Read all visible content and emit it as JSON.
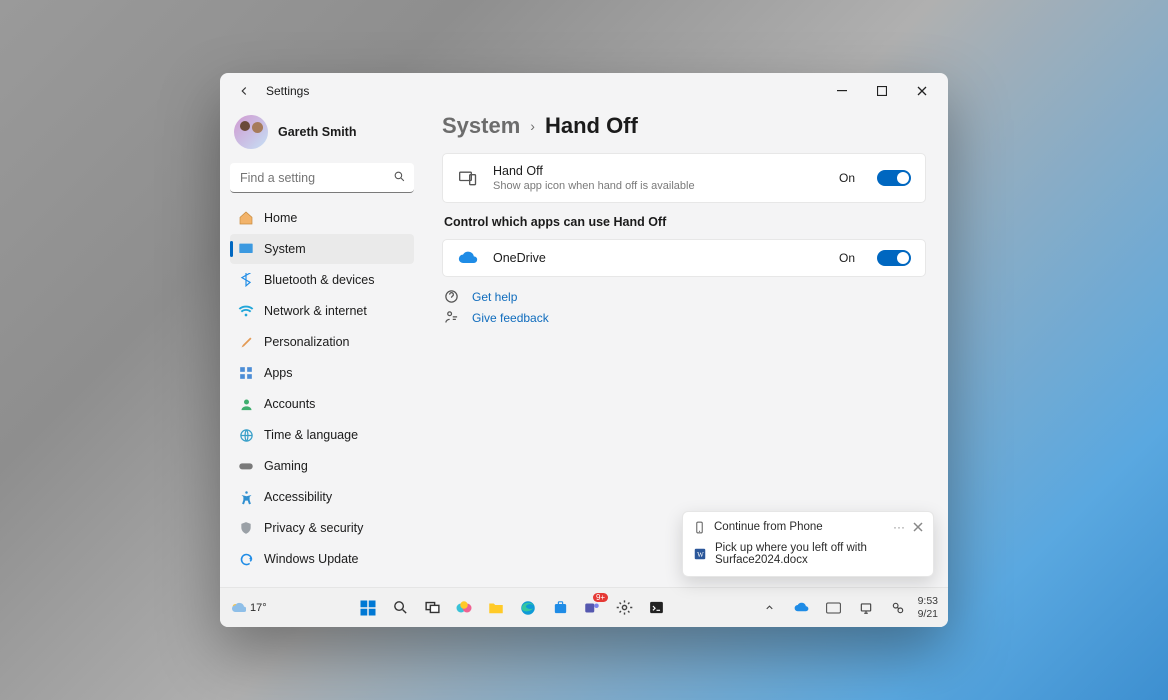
{
  "titlebar": {
    "title": "Settings"
  },
  "profile": {
    "name": "Gareth Smith"
  },
  "search": {
    "placeholder": "Find a setting"
  },
  "sidebar": {
    "items": [
      {
        "label": "Home",
        "icon": "home-icon"
      },
      {
        "label": "System",
        "icon": "system-icon"
      },
      {
        "label": "Bluetooth & devices",
        "icon": "bluetooth-icon"
      },
      {
        "label": "Network & internet",
        "icon": "wifi-icon"
      },
      {
        "label": "Personalization",
        "icon": "brush-icon"
      },
      {
        "label": "Apps",
        "icon": "apps-icon"
      },
      {
        "label": "Accounts",
        "icon": "person-icon"
      },
      {
        "label": "Time & language",
        "icon": "globe-icon"
      },
      {
        "label": "Gaming",
        "icon": "gamepad-icon"
      },
      {
        "label": "Accessibility",
        "icon": "accessibility-icon"
      },
      {
        "label": "Privacy & security",
        "icon": "shield-icon"
      },
      {
        "label": "Windows Update",
        "icon": "update-icon"
      }
    ]
  },
  "breadcrumb": {
    "parent": "System",
    "chev": "›",
    "current": "Hand Off"
  },
  "handoff_card": {
    "title": "Hand Off",
    "subtitle": "Show app icon when hand off is available",
    "state_label": "On"
  },
  "section_title": "Control which apps can use Hand Off",
  "onedrive_card": {
    "title": "OneDrive",
    "state_label": "On"
  },
  "help": {
    "get_help": "Get help",
    "give_feedback": "Give feedback"
  },
  "toast": {
    "title": "Continue from Phone",
    "body": "Pick up where you left off with Surface2024.docx"
  },
  "taskbar": {
    "weather_temp": "17°",
    "teams_badge": "9+",
    "clock_time": "9:53",
    "clock_date": "9/21"
  }
}
